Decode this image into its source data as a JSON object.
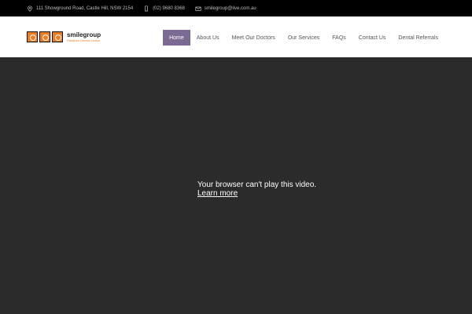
{
  "topbar": {
    "address": "111 Showground Road, Castle Hill, NSW 2154",
    "phone": "(02) 9680 8368",
    "email": "smilegroup@live.com.au"
  },
  "logo": {
    "brand": "smilegroup",
    "tagline": "Pavilions Dental Centre"
  },
  "nav": {
    "items": [
      "Home",
      "About Us",
      "Meet Our Doctors",
      "Our Services",
      "FAQs",
      "Contact Us",
      "Dental Referrals"
    ],
    "active": "Home"
  },
  "video": {
    "message": "Your browser can't play this video.",
    "link": "Learn more"
  },
  "colors": {
    "topbar_bg": "#000000",
    "accent_nav": "#7b6a94",
    "logo_orange": "#f07c22",
    "video_bg": "#2b2b2b"
  }
}
